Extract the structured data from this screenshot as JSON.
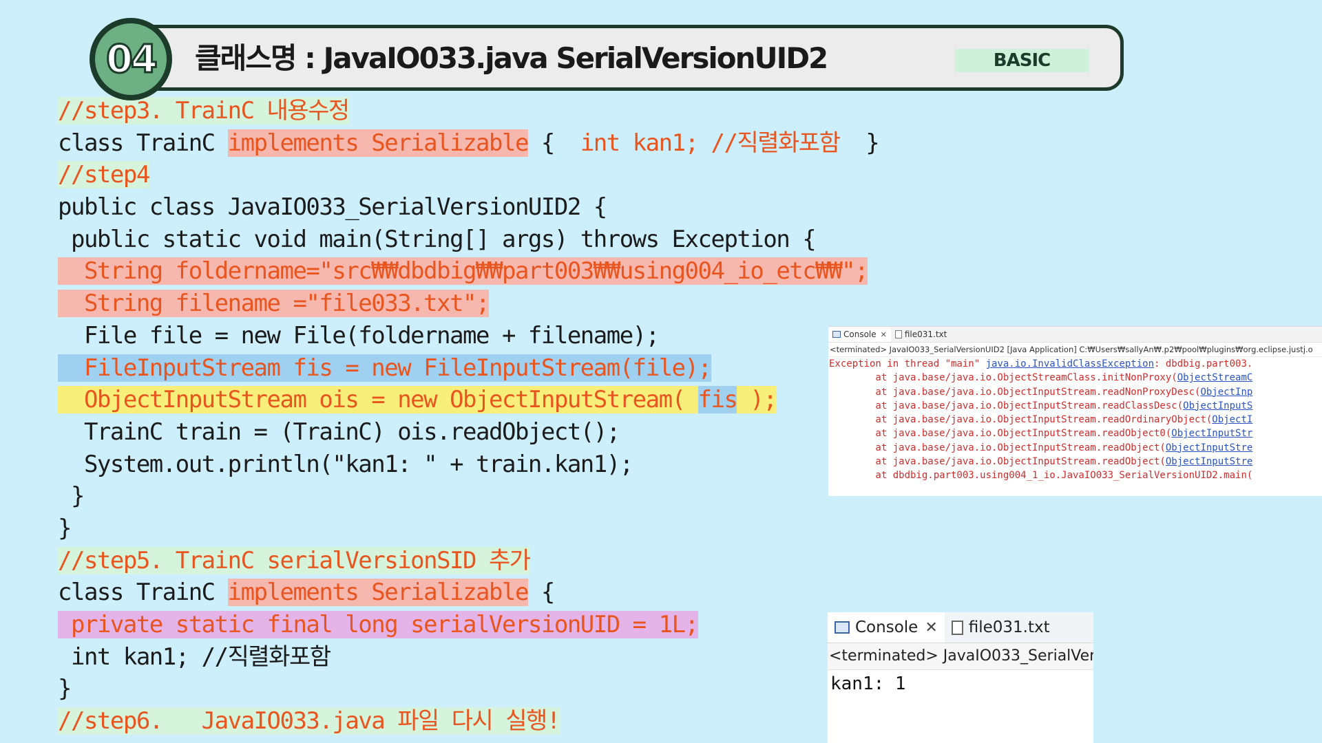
{
  "header": {
    "number": "04",
    "title": "클래스명 : JavaIO033.java  SerialVersionUID2",
    "level": "BASIC"
  },
  "code": {
    "l1": "//step3. TrainC 내용수정",
    "l2a": "class TrainC ",
    "l2b": "implements Serializable",
    "l2c": " {  ",
    "l2d": "int kan1; //직렬화포함",
    "l2e": "  }",
    "l3": "//step4",
    "l4": "public class JavaIO033_SerialVersionUID2 {",
    "l5": " public static void main(String[] args) throws Exception {",
    "l6": "  String foldername=\"src₩₩dbdbig₩₩part003₩₩using004_io_etc₩₩\";",
    "l7": "  String filename =\"file033.txt\";",
    "l8": "  File file = new File(foldername + filename);",
    "l9": "  FileInputStream fis = new FileInputStream(file);",
    "l10a": "  ObjectInputStream ois = new ObjectInputStream( ",
    "l10b": "fis",
    "l10c": " );",
    "l11": "  TrainC train = (TrainC) ois.readObject();",
    "l12": "  System.out.println(\"kan1: \" + train.kan1);",
    "l13": " }",
    "l14": "}",
    "l15": "//step5. TrainC serialVersionSID 추가",
    "l16a": "class TrainC ",
    "l16b": "implements Serializable",
    "l16c": " {",
    "l17": " private static final long serialVersionUID = 1L;",
    "l18": " int kan1; //직렬화포함",
    "l19": "}",
    "l20": "//step6.   JavaIO033.java 파일 다시 실행!"
  },
  "console1": {
    "tab_console": "Console",
    "tab_file": "file031.txt",
    "terminated": "<terminated> JavaIO033_SerialVersionUID2 [Java Application] C:₩Users₩sallyAn₩.p2₩pool₩plugins₩org.eclipse.justj.o",
    "ex_prefix": "Exception in thread \"main\" ",
    "ex_link": "java.io.InvalidClassException",
    "ex_suffix": ": dbdbig.part003.",
    "t1": "        at java.base/java.io.ObjectStreamClass.initNonProxy(",
    "t1l": "ObjectStreamC",
    "t2": "        at java.base/java.io.ObjectInputStream.readNonProxyDesc(",
    "t2l": "ObjectInp",
    "t3": "        at java.base/java.io.ObjectInputStream.readClassDesc(",
    "t3l": "ObjectInputS",
    "t4": "        at java.base/java.io.ObjectInputStream.readOrdinaryObject(",
    "t4l": "ObjectI",
    "t5": "        at java.base/java.io.ObjectInputStream.readObject0(",
    "t5l": "ObjectInputStr",
    "t6": "        at java.base/java.io.ObjectInputStream.readObject(",
    "t6l": "ObjectInputStre",
    "t7": "        at java.base/java.io.ObjectInputStream.readObject(",
    "t7l": "ObjectInputStre",
    "t8": "        at dbdbig.part003.using004_1_io.JavaIO033_SerialVersionUID2.main("
  },
  "console2": {
    "tab_console": "Console",
    "tab_file": "file031.txt",
    "terminated": "<terminated> JavaIO033_SerialVers",
    "output": "kan1: 1"
  }
}
